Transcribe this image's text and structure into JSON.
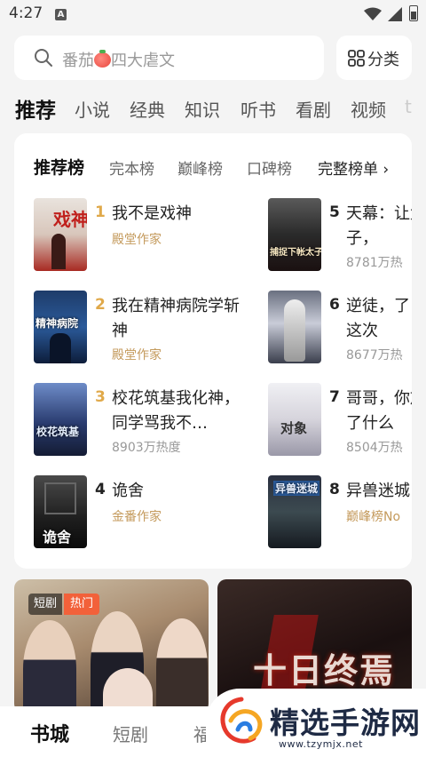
{
  "status_bar": {
    "time": "4:27",
    "notification_letter": "A"
  },
  "search": {
    "placeholder_prefix": "番茄",
    "placeholder_suffix": "四大虐文"
  },
  "category_button": {
    "label": "分类"
  },
  "top_tabs": [
    {
      "label": "推荐",
      "active": true
    },
    {
      "label": "小说"
    },
    {
      "label": "经典"
    },
    {
      "label": "知识"
    },
    {
      "label": "听书"
    },
    {
      "label": "看剧"
    },
    {
      "label": "视频"
    },
    {
      "label": "t"
    }
  ],
  "rank_card": {
    "tabs": [
      {
        "label": "推荐榜",
        "active": true
      },
      {
        "label": "完本榜"
      },
      {
        "label": "巅峰榜"
      },
      {
        "label": "口碑榜"
      },
      {
        "label": "完整榜单 ›"
      }
    ],
    "books": [
      {
        "rank": "1",
        "title": "我不是戏神",
        "meta": "殿堂作家",
        "meta_type": "author",
        "cover_text": "戏神"
      },
      {
        "rank": "2",
        "title": "我在精神病院学斩神",
        "meta": "殿堂作家",
        "meta_type": "author",
        "cover_text": "精神病院"
      },
      {
        "rank": "3",
        "title": "校花筑基我化神，同学骂我不…",
        "meta": "8903万热度",
        "meta_type": "heat",
        "cover_text": "校花筑基"
      },
      {
        "rank": "4",
        "title": "诡舍",
        "meta": "金番作家",
        "meta_type": "author",
        "cover_text": "诡舍"
      },
      {
        "rank": "5",
        "title": "天幕：让太子，",
        "meta": "8781万热",
        "meta_type": "heat",
        "cover_text": "捕捉下帐太子"
      },
      {
        "rank": "6",
        "title": "逆徒，了，这次",
        "meta": "8677万热",
        "meta_type": "heat",
        "cover_text": ""
      },
      {
        "rank": "7",
        "title": "哥哥，你放了什么",
        "meta": "8504万热",
        "meta_type": "heat",
        "cover_text": "对象"
      },
      {
        "rank": "8",
        "title": "异兽迷城",
        "meta": "巅峰榜No",
        "meta_type": "author",
        "cover_text": "异兽迷城"
      }
    ]
  },
  "promos": [
    {
      "badge_type": "短剧",
      "badge_hot": "热门"
    },
    {
      "title": "十日终焉"
    }
  ],
  "bottom_nav": [
    {
      "label": "书城",
      "active": true
    },
    {
      "label": "短剧"
    },
    {
      "label": "福"
    }
  ],
  "watermark": {
    "text": "精选手游网",
    "url": "www.tzymjx.net"
  },
  "colors": {
    "accent_gold": "#c49a5c",
    "rank_top": "#e0a94a",
    "rank_normal": "#222222",
    "hot_badge": "#f2613a"
  }
}
